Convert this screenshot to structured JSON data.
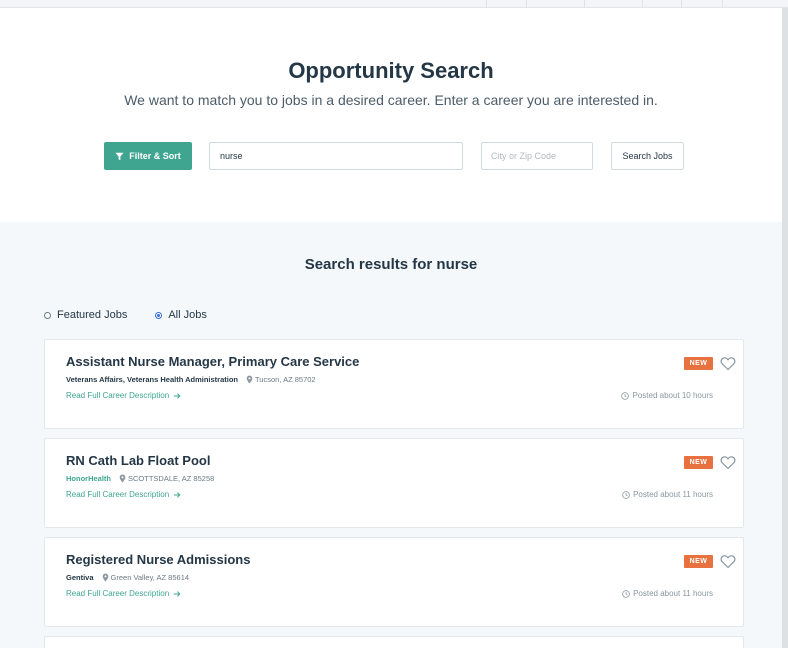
{
  "hero": {
    "title": "Opportunity Search",
    "subtitle": "We want to match you to jobs in a desired career. Enter a career you are interested in."
  },
  "search": {
    "filter_label": "Filter & Sort",
    "query_value": "nurse",
    "location_placeholder": "City or Zip Code",
    "location_value": "",
    "search_button_label": "Search Jobs"
  },
  "results": {
    "title": "Search results for nurse",
    "filters": [
      {
        "label": "Featured Jobs",
        "selected": false
      },
      {
        "label": "All Jobs",
        "selected": true
      }
    ],
    "read_link_label": "Read Full Career Description",
    "jobs": [
      {
        "title": "Assistant Nurse Manager, Primary Care Service",
        "company": "Veterans Affairs, Veterans Health Administration",
        "location": "Tucson, AZ 85702",
        "posted": "Posted about 10 hours",
        "badge": "NEW"
      },
      {
        "title": "RN Cath Lab Float Pool",
        "company": "HonorHealth",
        "location": "SCOTTSDALE, AZ 85258",
        "posted": "Posted about 11 hours",
        "badge": "NEW"
      },
      {
        "title": "Registered Nurse Admissions",
        "company": "Gentiva",
        "location": "Green Valley, AZ 85614",
        "posted": "Posted about 11 hours",
        "badge": "NEW"
      }
    ]
  },
  "colors": {
    "accent": "#3fa591",
    "new_badge": "#e8723f",
    "text": "#243746",
    "radio_selected": "#3b6fd8"
  },
  "icons": {
    "filter": "filter-funnel-icon",
    "pin": "map-pin-icon",
    "arrow": "arrow-right-icon",
    "clock": "clock-icon",
    "favorite": "heart-outline-icon"
  }
}
